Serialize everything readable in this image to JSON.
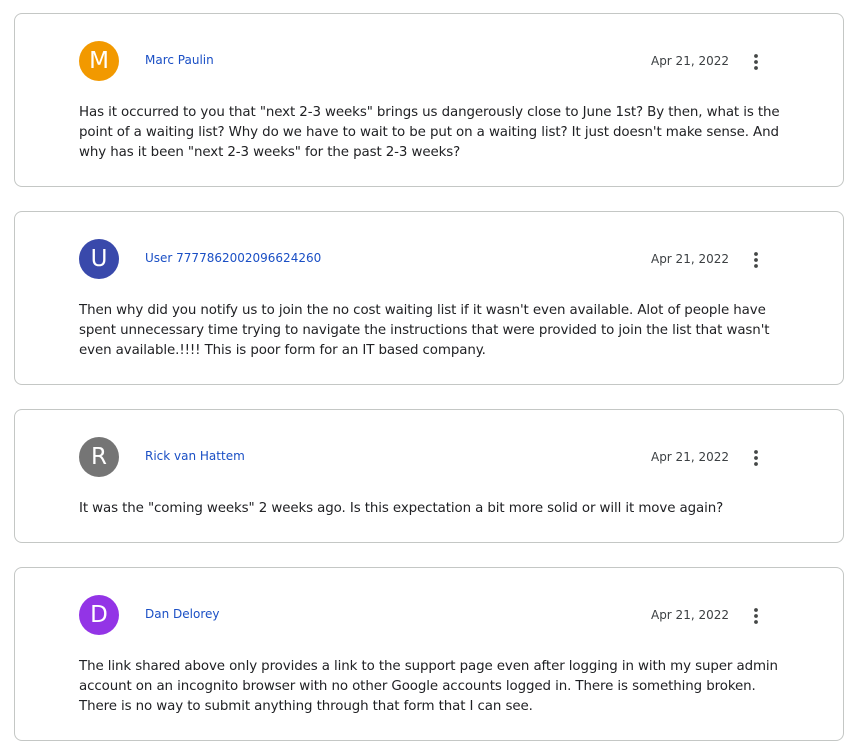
{
  "comments": [
    {
      "avatar_letter": "M",
      "avatar_color": "#f29900",
      "author": "Marc Paulin",
      "date": "Apr 21, 2022",
      "menu_icon": "more-vertical-icon",
      "text": "Has it occurred to you that \"next 2-3 weeks\" brings us dangerously close to June 1st?  By then, what is the\npoint of a waiting list?  Why do we have to wait to be put on a waiting list?  It just doesn't make sense.  And\nwhy has it been \"next 2-3 weeks\" for the past 2-3 weeks?"
    },
    {
      "avatar_letter": "U",
      "avatar_color": "#3949ab",
      "author": "User 7777862002096624260",
      "date": "Apr 21, 2022",
      "menu_icon": "more-vertical-icon",
      "text": "Then why did you notify us to join the no cost waiting list if it wasn't even available.  Alot of people have\nspent unnecessary time trying to navigate the instructions that were provided to join the list that wasn't\neven available.!!!!  This is poor form for an IT based company."
    },
    {
      "avatar_letter": "R",
      "avatar_color": "#757575",
      "author": "Rick van Hattem",
      "date": "Apr 21, 2022",
      "menu_icon": "more-vertical-icon",
      "text": "It was the \"coming weeks\" 2 weeks ago. Is this expectation a bit more solid or will it move again?"
    },
    {
      "avatar_letter": "D",
      "avatar_color": "#9334e6",
      "author": "Dan Delorey",
      "date": "Apr 21, 2022",
      "menu_icon": "more-vertical-icon",
      "text": "The link shared above only provides a link to the support page even after logging in with my super admin\naccount on an incognito browser with no other Google accounts logged in. There is something broken.\nThere is no way to submit anything through that form that I can see."
    }
  ]
}
